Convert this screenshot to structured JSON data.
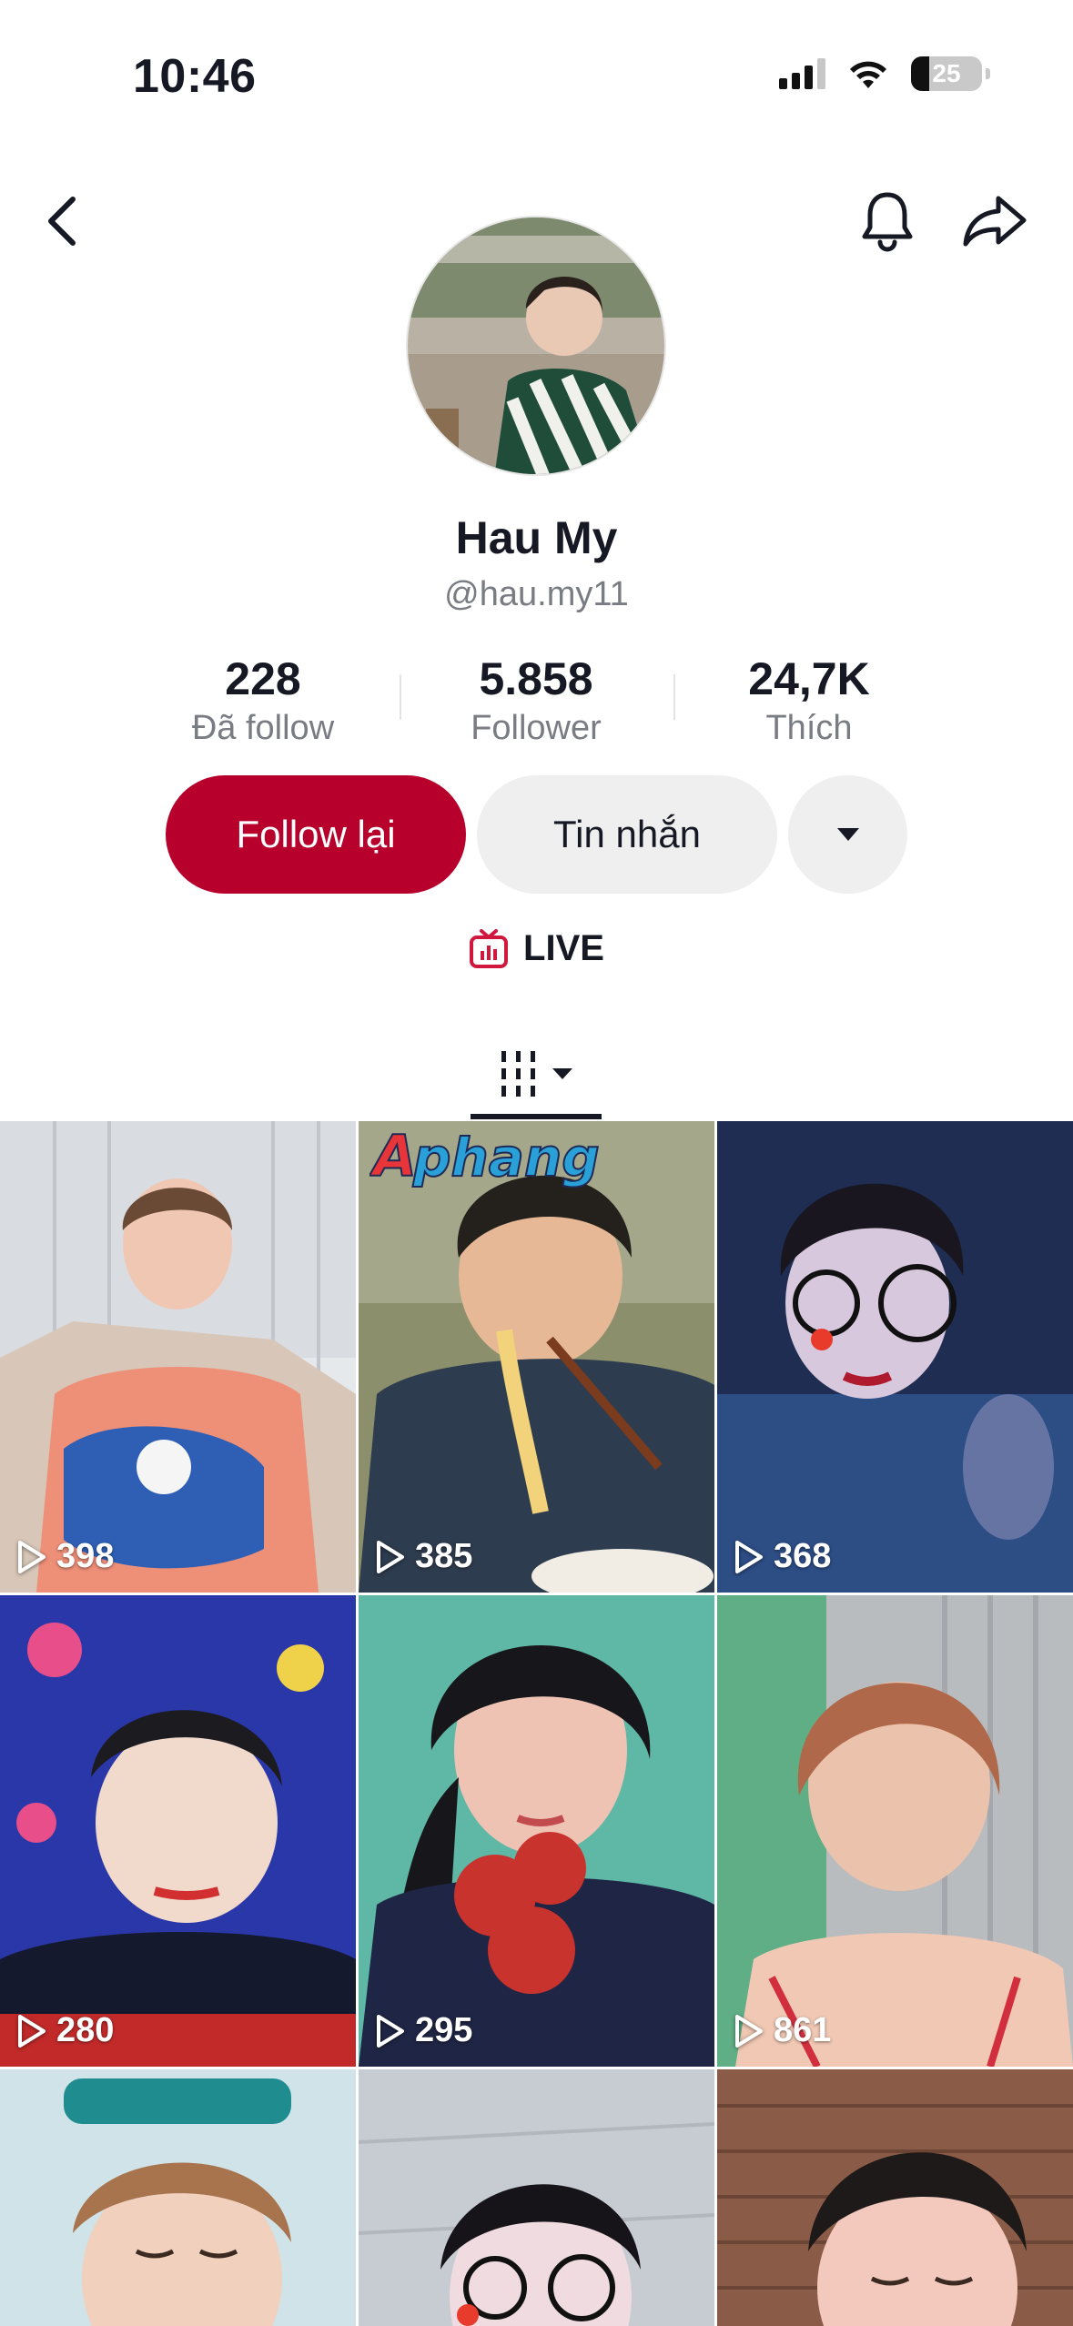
{
  "status_bar": {
    "time": "10:46",
    "battery": "25"
  },
  "profile": {
    "display_name": "Hau My",
    "username": "@hau.my11"
  },
  "stats": [
    {
      "value": "228",
      "label": "Đã follow"
    },
    {
      "value": "5.858",
      "label": "Follower"
    },
    {
      "value": "24,7K",
      "label": "Thích"
    }
  ],
  "actions": {
    "follow_back": "Follow lại",
    "message": "Tin nhắn"
  },
  "live": {
    "label": "LIVE"
  },
  "videos": [
    {
      "views": "398"
    },
    {
      "views": "385",
      "overlay_text": "Aphang"
    },
    {
      "views": "368"
    },
    {
      "views": "280"
    },
    {
      "views": "295"
    },
    {
      "views": "861"
    },
    {
      "views": ""
    },
    {
      "views": ""
    },
    {
      "views": ""
    }
  ],
  "colors": {
    "accent": "#b8002c",
    "secondary_button": "#efeff0",
    "muted_text": "#7a7c83",
    "live_icon": "#d0183f"
  },
  "icons": {
    "back": "chevron-left-icon",
    "bell": "bell-icon",
    "share": "share-arrow-icon",
    "more": "caret-down-icon",
    "live": "tv-live-icon",
    "grid_tab": "grid-icon",
    "play": "play-icon"
  }
}
